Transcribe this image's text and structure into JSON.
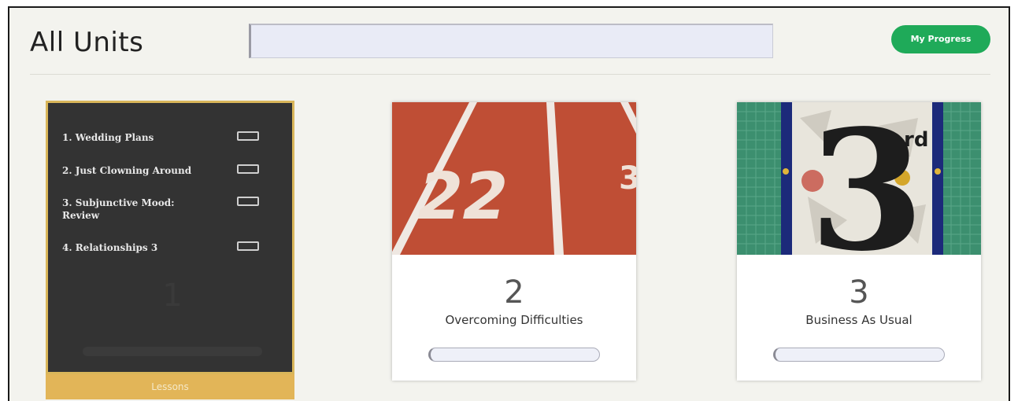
{
  "header": {
    "title": "All Units",
    "search_value": "",
    "my_progress_label": "My Progress"
  },
  "units": [
    {
      "number": "1",
      "lessons": [
        {
          "label": "1. Wedding Plans"
        },
        {
          "label": "2. Just Clowning Around"
        },
        {
          "label": "3. Subjunctive Mood: Review"
        },
        {
          "label": "4. Relationships 3"
        }
      ],
      "lessons_button": "Lessons"
    },
    {
      "number": "2",
      "title": "Overcoming Difficulties",
      "image": "running-track-lane-2",
      "progress": 0
    },
    {
      "number": "3",
      "title": "Business As Usual",
      "image": "mosaic-number-3",
      "progress": 0
    }
  ],
  "colors": {
    "accent_green": "#1faa59",
    "lessons_gold": "#e2b558",
    "panel_dark": "#333333"
  }
}
